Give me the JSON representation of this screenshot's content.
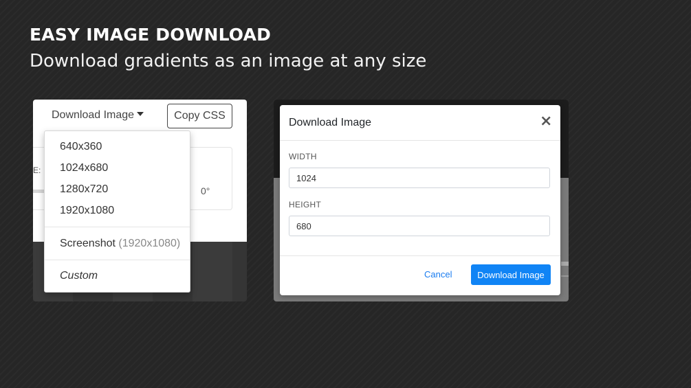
{
  "headline": "EASY IMAGE DOWNLOAD",
  "subline": "Download gradients as an image at any size",
  "left_panel": {
    "dropdown_toggle_label": "Download Image",
    "copy_css_label": "Copy CSS",
    "background_label": "E:",
    "background_angle": "0°",
    "dropdown_items": [
      "640x360",
      "1024x680",
      "1280x720",
      "1920x1080"
    ],
    "screenshot_label": "Screenshot",
    "screenshot_size": "(1920x1080)",
    "custom_label": "Custom"
  },
  "modal": {
    "title": "Download Image",
    "close_glyph": "×",
    "width_label": "WIDTH",
    "width_value": "1024",
    "height_label": "HEIGHT",
    "height_value": "680",
    "cancel_label": "Cancel",
    "download_label": "Download Image"
  },
  "colors": {
    "page_background": "#262626",
    "primary_button": "#1084f5",
    "link": "#1a7cf0"
  },
  "icons": {
    "caret": "caret-down-icon",
    "close": "close-icon"
  }
}
